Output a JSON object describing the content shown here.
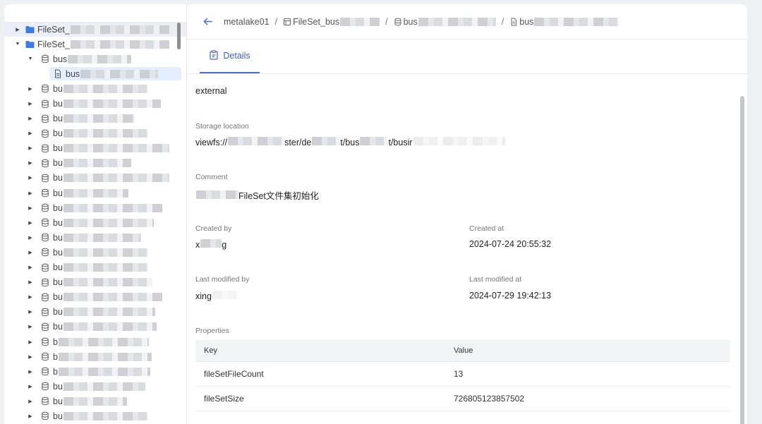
{
  "sidebar": {
    "nodes": [
      {
        "level": 0,
        "type": "folder",
        "label": "FileSet_",
        "state": "collapsed",
        "selected_top": true
      },
      {
        "level": 0,
        "type": "folder",
        "label": "FileSet_",
        "state": "expanded"
      },
      {
        "level": 1,
        "type": "db",
        "label": "bus",
        "state": "expanded"
      },
      {
        "level": 2,
        "type": "file",
        "label": "bus",
        "selected": true
      },
      {
        "level": 1,
        "type": "db",
        "label": "bu",
        "state": "collapsed"
      },
      {
        "level": 1,
        "type": "db",
        "label": "bu",
        "state": "collapsed"
      },
      {
        "level": 1,
        "type": "db",
        "label": "bu",
        "state": "collapsed"
      },
      {
        "level": 1,
        "type": "db",
        "label": "bu",
        "state": "collapsed"
      },
      {
        "level": 1,
        "type": "db",
        "label": "bu",
        "state": "collapsed"
      },
      {
        "level": 1,
        "type": "db",
        "label": "bu",
        "state": "collapsed"
      },
      {
        "level": 1,
        "type": "db",
        "label": "bu",
        "state": "collapsed"
      },
      {
        "level": 1,
        "type": "db",
        "label": "bu",
        "state": "collapsed"
      },
      {
        "level": 1,
        "type": "db",
        "label": "bu",
        "state": "collapsed"
      },
      {
        "level": 1,
        "type": "db",
        "label": "bu",
        "state": "collapsed"
      },
      {
        "level": 1,
        "type": "db",
        "label": "bu",
        "state": "collapsed"
      },
      {
        "level": 1,
        "type": "db",
        "label": "bu",
        "state": "collapsed"
      },
      {
        "level": 1,
        "type": "db",
        "label": "bu",
        "state": "collapsed"
      },
      {
        "level": 1,
        "type": "db",
        "label": "bu",
        "state": "collapsed"
      },
      {
        "level": 1,
        "type": "db",
        "label": "bu",
        "state": "collapsed"
      },
      {
        "level": 1,
        "type": "db",
        "label": "bu",
        "state": "collapsed"
      },
      {
        "level": 1,
        "type": "db",
        "label": "bu",
        "state": "collapsed"
      },
      {
        "level": 1,
        "type": "db",
        "label": "b",
        "state": "collapsed"
      },
      {
        "level": 1,
        "type": "db",
        "label": "b",
        "state": "collapsed"
      },
      {
        "level": 1,
        "type": "db",
        "label": "b",
        "state": "collapsed"
      },
      {
        "level": 1,
        "type": "db",
        "label": "bu",
        "state": "collapsed"
      },
      {
        "level": 1,
        "type": "db",
        "label": "bu",
        "state": "collapsed"
      },
      {
        "level": 1,
        "type": "db",
        "label": "bu",
        "state": "collapsed"
      }
    ]
  },
  "breadcrumb": {
    "root": "metalake01",
    "catalog": "FileSet_bus",
    "schema": "bus",
    "fileset": "bus",
    "separator": "/"
  },
  "tabs": [
    {
      "label": "Details",
      "active": true
    }
  ],
  "details": {
    "type_value": "external",
    "storage_location_label": "Storage location",
    "storage_location_value": "viewfs://",
    "storage_location_value_mid": "ster/de",
    "storage_location_value_tail1": "t/bus",
    "storage_location_value_tail2": "t/busir",
    "comment_label": "Comment",
    "comment_value": "FileSet文件集初始化",
    "created_by_label": "Created by",
    "created_by_value": "x",
    "created_by_value_tail": "g",
    "created_at_label": "Created at",
    "created_at_value": "2024-07-24 20:55:32",
    "last_modified_by_label": "Last modified by",
    "last_modified_by_value": "xing",
    "last_modified_at_label": "Last modified at",
    "last_modified_at_value": "2024-07-29 19:42:13",
    "properties_label": "Properties"
  },
  "properties_table": {
    "headers": [
      "Key",
      "Value"
    ],
    "rows": [
      [
        "fileSetFileCount",
        "13"
      ],
      [
        "fileSetSize",
        "726805123857502"
      ]
    ]
  },
  "colors": {
    "accent": "#4b6ad9",
    "folder": "#3d7be0",
    "selected_bg": "#e3efff"
  },
  "icons": {
    "back": "arrow-left-icon",
    "catalog": "table-icon",
    "schema": "database-icon",
    "fileset": "file-icon",
    "tab": "clipboard-icon"
  }
}
